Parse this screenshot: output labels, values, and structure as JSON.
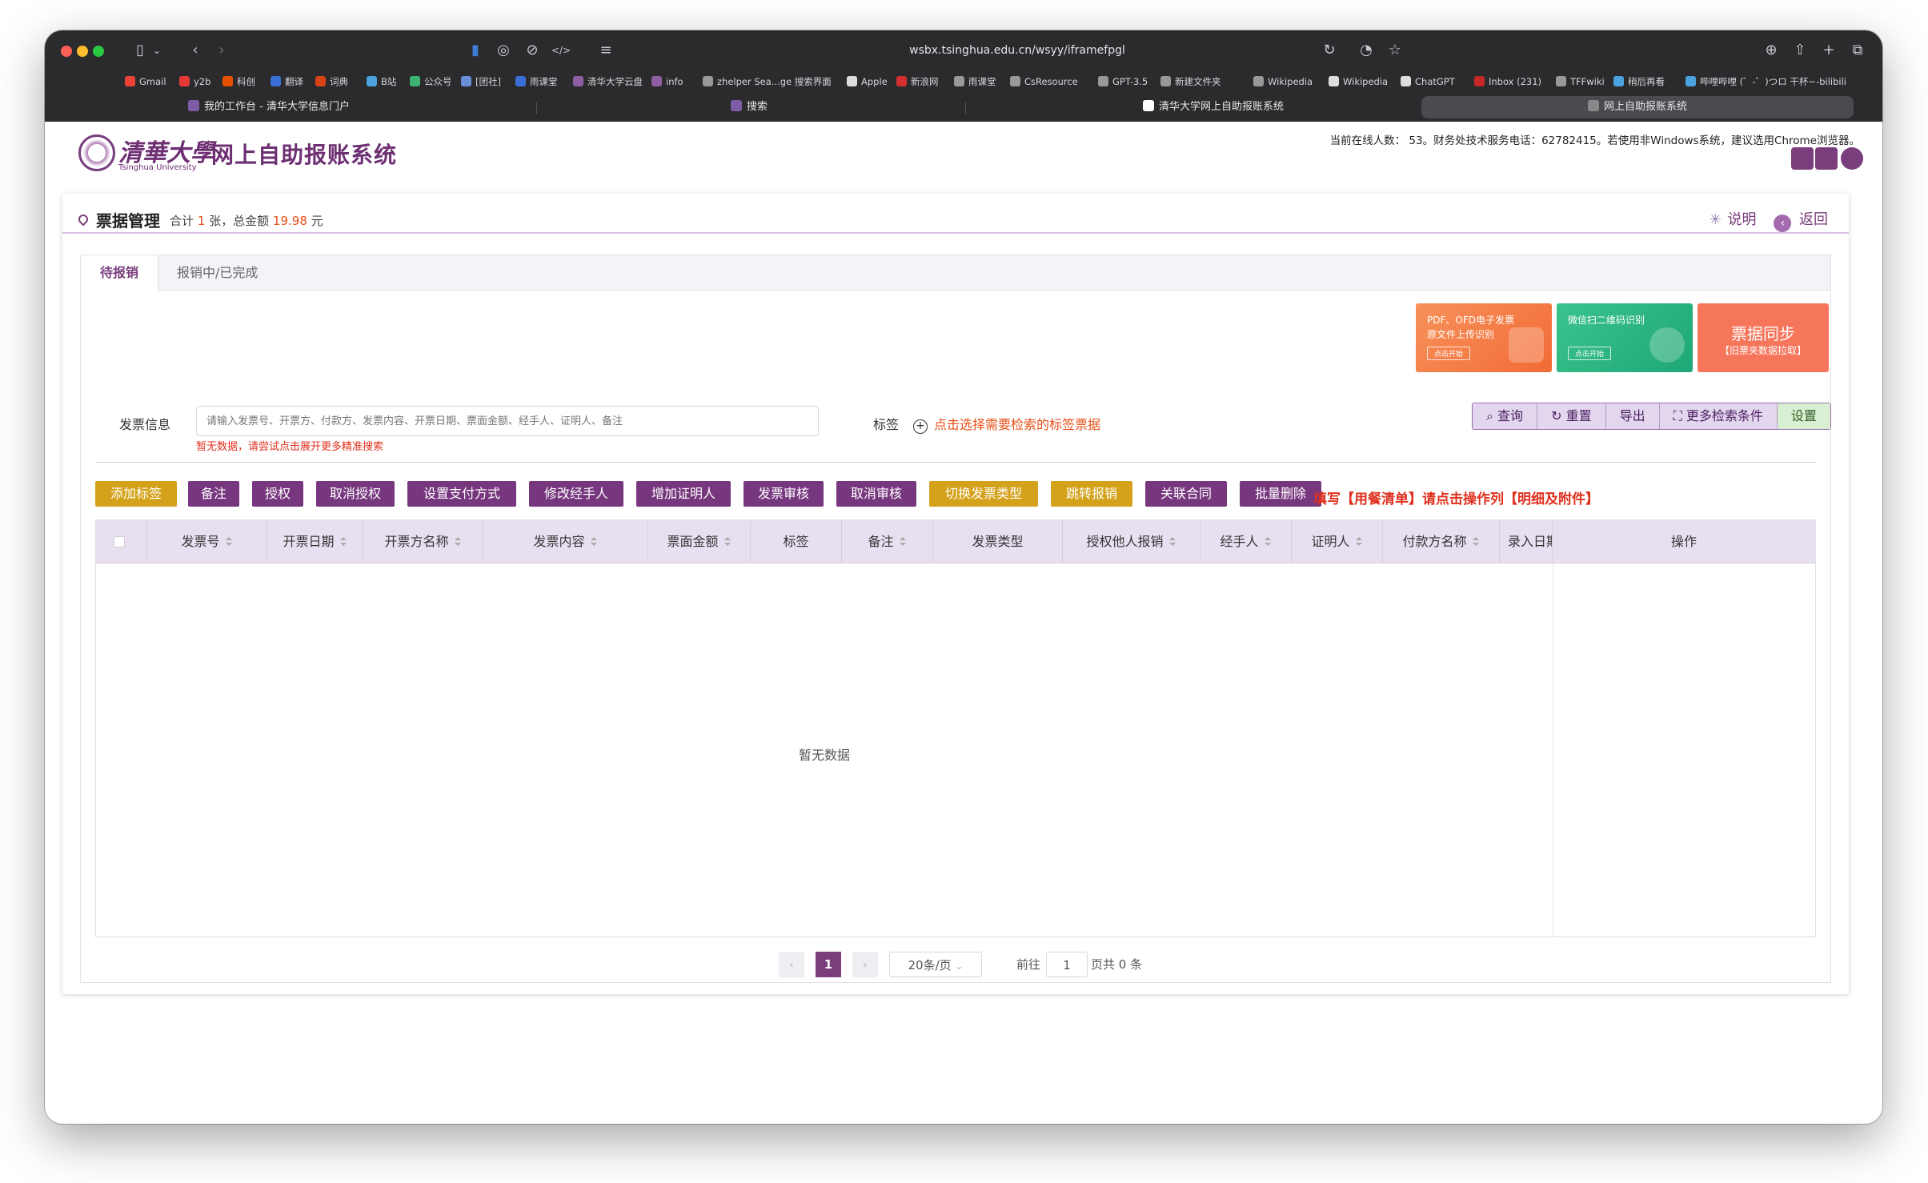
{
  "browser": {
    "url": "wsbx.tsinghua.edu.cn/wsyy/iframefpgl",
    "bookmarks": [
      "Gmail",
      "y2b",
      "科创",
      "翻译",
      "词典",
      "B站",
      "公众号",
      "[团社]",
      "雨课堂",
      "清华大学云盘",
      "info",
      "zhelper Sea...ge 搜索界面",
      "Apple",
      "新浪网",
      "雨课堂",
      "CsResource",
      "GPT-3.5",
      "新建文件夹",
      "Wikipedia",
      "Wikipedia",
      "ChatGPT",
      "Inbox (231)",
      "TFFwiki",
      "稍后再看",
      "哔哩哔哩 (゜-゜)つロ 干杯~-bilibili"
    ],
    "tabs": [
      "我的工作台 - 清华大学信息门户",
      "搜索",
      "清华大学网上自助报账系统",
      "网上自助报账系统"
    ]
  },
  "header": {
    "logo_cn": "清華大學",
    "logo_en": "Tsinghua University",
    "system_title": "网上自助报账系统",
    "notice": "当前在线人数： 53。财务处技术服务电话：62782415。若使用非Windows系统，建议选用Chrome浏览器。"
  },
  "card": {
    "title": "票据管理",
    "summary_prefix": "合计",
    "count": "1",
    "summary_mid": "张，总金额",
    "amount": "19.98",
    "summary_suffix": "元",
    "help_label": "说明",
    "back_label": "返回"
  },
  "tabs": [
    {
      "label": "待报销"
    },
    {
      "label": "报销中/已完成"
    }
  ],
  "promos": [
    {
      "line1": "PDF、OFD电子发票",
      "line2": "原文件上传识别",
      "button": "点击开始"
    },
    {
      "line1": "微信扫二维码识别",
      "button": "点击开始"
    },
    {
      "title": "票据同步",
      "subtitle": "【旧票夹数据拉取】"
    }
  ],
  "search": {
    "invoice_label": "发票信息",
    "placeholder": "请输入发票号、开票方、付款方、发票内容、开票日期、票面金额、经手人、证明人、备注",
    "hint": "暂无数据，请尝试点击展开更多精准搜索",
    "tag_label": "标签",
    "tag_link": "点击选择需要检索的标签票据",
    "buttons": [
      "查询",
      "重置",
      "导出",
      "更多检索条件",
      "设置"
    ]
  },
  "actions": [
    "添加标签",
    "备注",
    "授权",
    "取消授权",
    "设置支付方式",
    "修改经手人",
    "增加证明人",
    "发票审核",
    "取消审核",
    "切换发票类型",
    "跳转报销",
    "关联合同",
    "批量删除"
  ],
  "action_tip": "填写【用餐清单】请点击操作列【明细及附件】",
  "table": {
    "columns": [
      "发票号",
      "开票日期",
      "开票方名称",
      "发票内容",
      "票面金额",
      "标签",
      "备注",
      "发票类型",
      "授权他人报销",
      "经手人",
      "证明人",
      "付款方名称",
      "录入日期",
      "操作"
    ],
    "empty_text": "暂无数据"
  },
  "pagination": {
    "current_page": "1",
    "page_size": "20条/页",
    "goto_label": "前往",
    "goto_value": "1",
    "total_text": "页共 0 条"
  }
}
